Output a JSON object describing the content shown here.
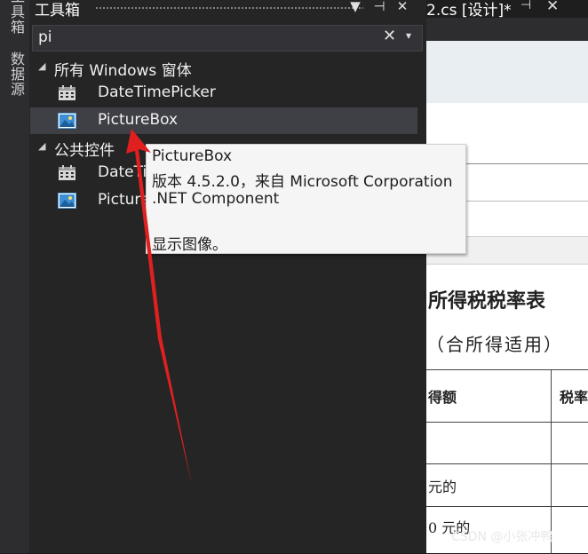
{
  "side_tabs": {
    "toolbox": "工具箱",
    "datasource": "数据源"
  },
  "toolbox": {
    "title": "工具箱",
    "buttons": {
      "dropdown": "▼",
      "pin": "⊣",
      "close": "✕"
    },
    "search": {
      "value": "pi",
      "clear": "✕",
      "menu": "▾"
    },
    "groups": [
      {
        "label": "所有 Windows 窗体",
        "items": [
          {
            "label": "DateTimePicker"
          },
          {
            "label": "PictureBox"
          }
        ]
      },
      {
        "label": "公共控件",
        "items": [
          {
            "label": "DateTimePicker"
          },
          {
            "label": "PictureBox"
          }
        ]
      }
    ]
  },
  "tooltip": {
    "name": "PictureBox",
    "version": "版本 4.5.2.0，来自 Microsoft Corporation",
    "type": ".NET Component",
    "description": "显示图像。"
  },
  "designer": {
    "tab_title": "2.cs [设计]*",
    "tab_pin": "⊣",
    "tab_close": "✕",
    "doc_lines": [
      "所得税税率表",
      "（合所得适用）",
      "得额",
      "税率",
      "元的",
      "0 元的"
    ]
  },
  "watermark": "CSDN @小张冲鸭",
  "colors": {
    "panel": "#252526",
    "selection": "#3f3f46",
    "arrow": "#e02020",
    "tooltip_bg": "#f5f5f5"
  }
}
